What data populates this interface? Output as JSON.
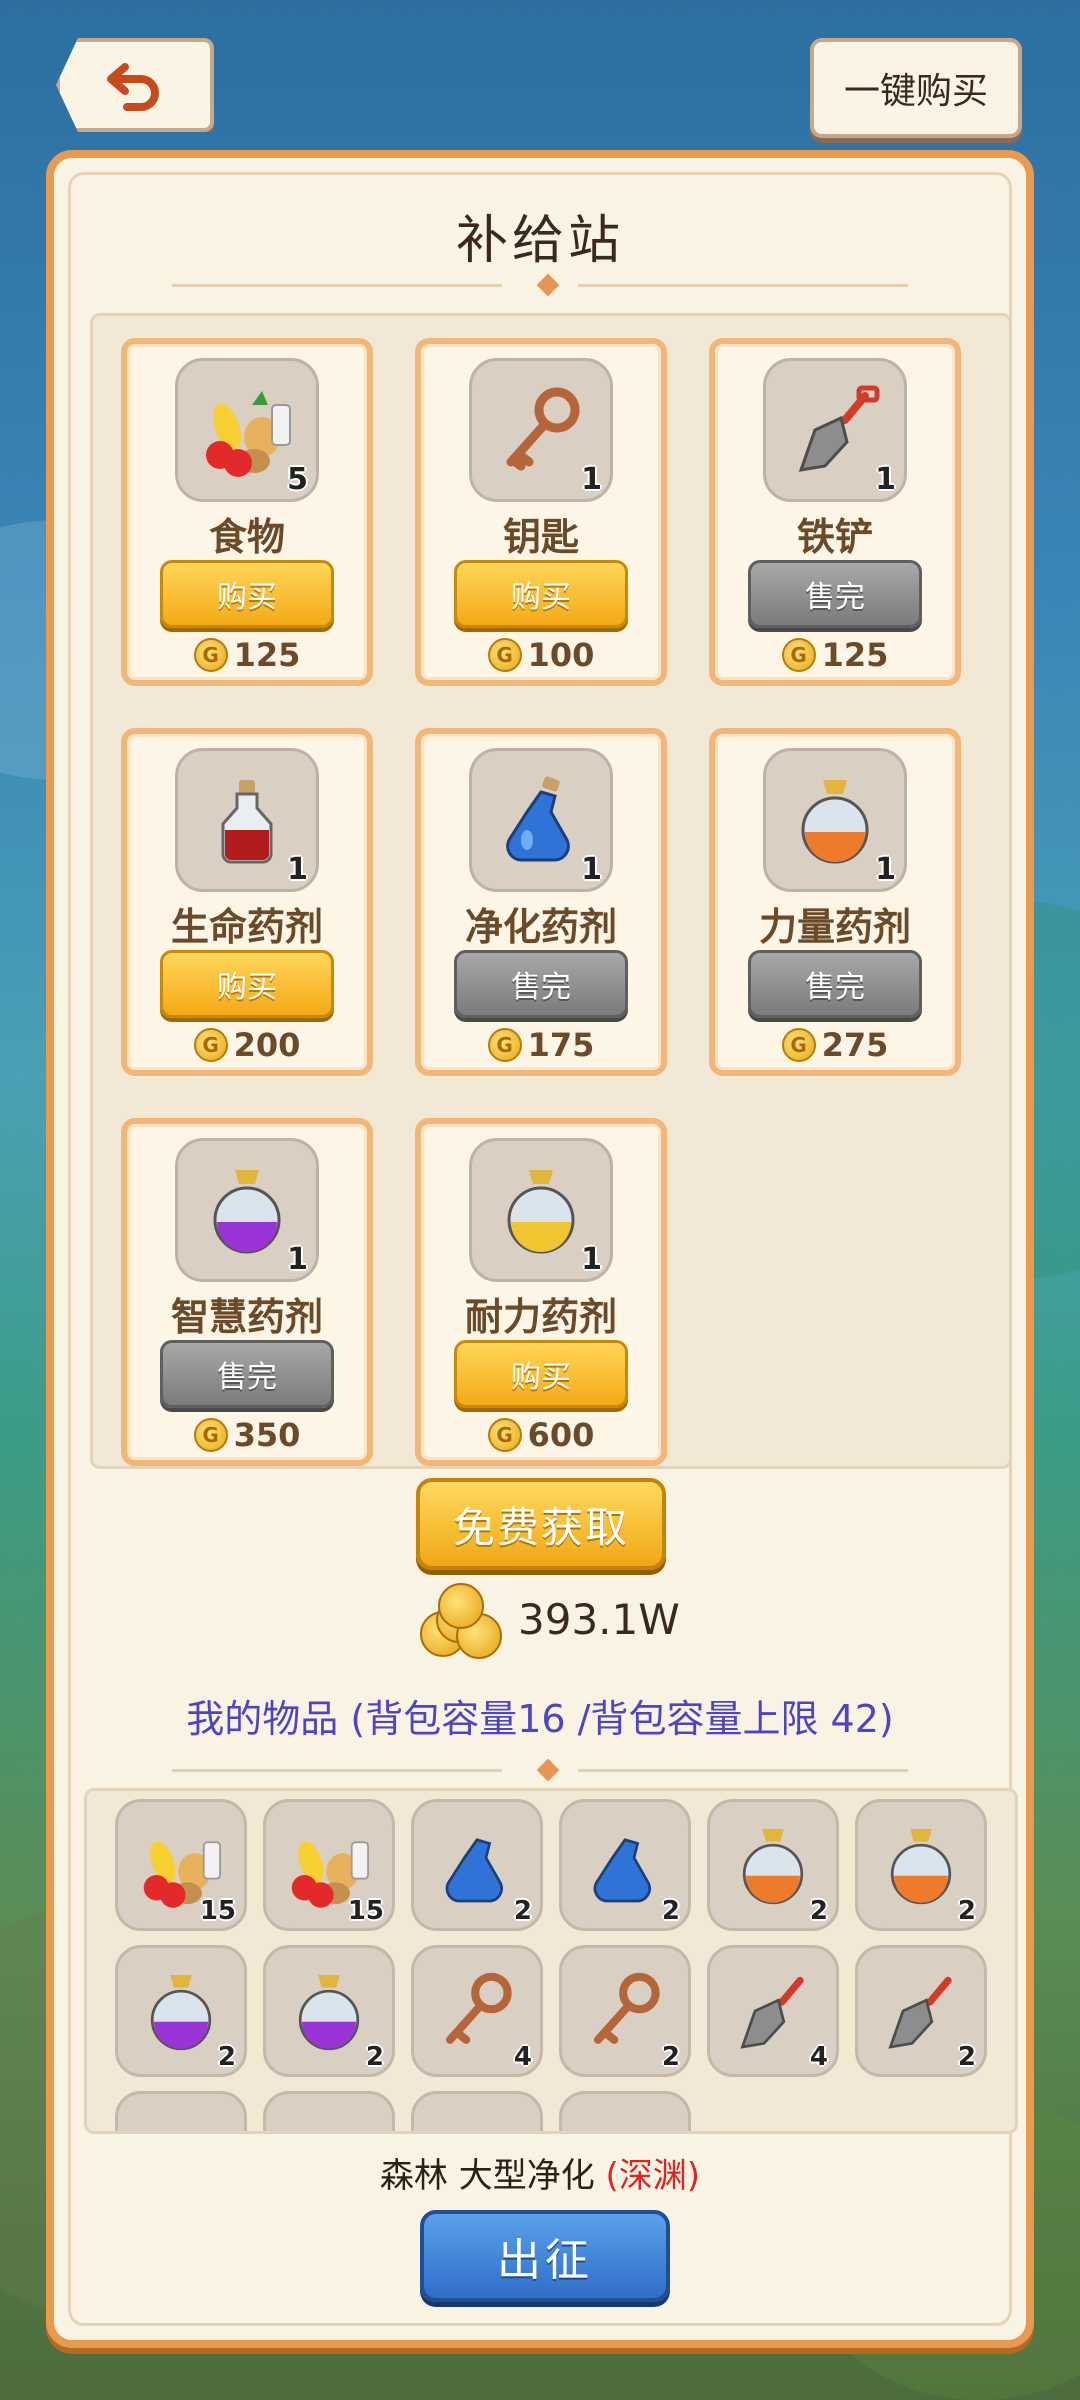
{
  "header": {
    "back_icon": "undo-arrow-icon",
    "buy_all_label": "一键购买"
  },
  "shop": {
    "title": "补给站",
    "items": [
      {
        "name": "食物",
        "qty": "5",
        "button": "购买",
        "status": "buy",
        "price": "125",
        "icon": "food-basket-icon"
      },
      {
        "name": "钥匙",
        "qty": "1",
        "button": "购买",
        "status": "buy",
        "price": "100",
        "icon": "key-icon"
      },
      {
        "name": "铁铲",
        "qty": "1",
        "button": "售完",
        "status": "sold",
        "price": "125",
        "icon": "shovel-icon"
      },
      {
        "name": "生命药剂",
        "qty": "1",
        "button": "购买",
        "status": "buy",
        "price": "200",
        "icon": "red-potion-icon"
      },
      {
        "name": "净化药剂",
        "qty": "1",
        "button": "售完",
        "status": "sold",
        "price": "175",
        "icon": "blue-potion-icon"
      },
      {
        "name": "力量药剂",
        "qty": "1",
        "button": "售完",
        "status": "sold",
        "price": "275",
        "icon": "orange-potion-icon"
      },
      {
        "name": "智慧药剂",
        "qty": "1",
        "button": "售完",
        "status": "sold",
        "price": "350",
        "icon": "purple-potion-icon"
      },
      {
        "name": "耐力药剂",
        "qty": "1",
        "button": "购买",
        "status": "buy",
        "price": "600",
        "icon": "yellow-potion-icon"
      }
    ],
    "free_label": "免费获取",
    "coin_total": "393.1W"
  },
  "inventory": {
    "title": "我的物品 (背包容量16 /背包容量上限 42)",
    "slots": [
      {
        "icon": "food-basket-icon",
        "qty": "15"
      },
      {
        "icon": "food-basket-icon",
        "qty": "15"
      },
      {
        "icon": "blue-potion-icon",
        "qty": "2"
      },
      {
        "icon": "blue-potion-icon",
        "qty": "2"
      },
      {
        "icon": "orange-potion-icon",
        "qty": "2"
      },
      {
        "icon": "orange-potion-icon",
        "qty": "2"
      },
      {
        "icon": "purple-potion-icon",
        "qty": "2"
      },
      {
        "icon": "purple-potion-icon",
        "qty": "2"
      },
      {
        "icon": "key-icon",
        "qty": "4"
      },
      {
        "icon": "key-icon",
        "qty": "2"
      },
      {
        "icon": "shovel-icon",
        "qty": "4"
      },
      {
        "icon": "shovel-icon",
        "qty": "2"
      }
    ]
  },
  "mission": {
    "location": "森林 大型净化",
    "difficulty": "(深渊)",
    "go_label": "出征"
  },
  "colors": {
    "panel_border": "#e89b4f",
    "buy_button": "#f3aa16",
    "sold_button": "#7b7b7b",
    "go_button": "#2f6ec9",
    "inventory_title": "#4f44c4",
    "difficulty": "#e02424"
  }
}
